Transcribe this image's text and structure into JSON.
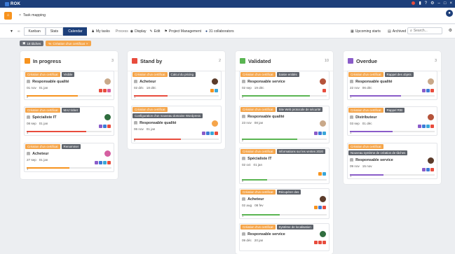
{
  "app": {
    "logo": "ROK"
  },
  "tab": {
    "label": "Task mapping"
  },
  "toolbar": {
    "views": [
      "Kanban",
      "Stats",
      "Calendar"
    ],
    "my_tasks": "My tasks",
    "process_label": "Process",
    "display": "Display",
    "edit": "Edit",
    "project": "Project Management",
    "collaborators": "31 collaborators",
    "upcoming": "Upcoming starts",
    "archived": "Archived",
    "search_placeholder": "Search..."
  },
  "filters": {
    "count_chip": "18 tâches",
    "tag_chip": "Création d'un certificat"
  },
  "columns": [
    {
      "title": "In progress",
      "count": "3",
      "color": "#f7931e",
      "cards": [
        {
          "tags": [
            "Création d'un certificat",
            "Visible"
          ],
          "role": "Responsable qualité",
          "d1": "01 nov",
          "d2": "01 jan",
          "progress": "2"
        },
        {
          "tags": [
            "Création d'un certificat",
            "MAJ ticket"
          ],
          "role": "Spécialiste IT",
          "d1": "08 sep",
          "d2": "01 jan",
          "progress": "3"
        },
        {
          "tags": [
            "Création d'un certificat",
            "Renommer"
          ],
          "role": "Acheteur",
          "d1": "27 sep",
          "d2": "01 jan",
          "progress": "1"
        }
      ]
    },
    {
      "title": "Stand by",
      "count": "2",
      "color": "#e84c3d",
      "cards": [
        {
          "tags": [
            "Création d'un certificat",
            "Calcul du pricing"
          ],
          "role": "Acheteur",
          "d1": "02 déc",
          "d2": "18 déc",
          "progress": "1"
        },
        {
          "tags": [
            "Création d'un certificat",
            "Configuration d'un nouveau domaine Wordpress"
          ],
          "role": "Responsable qualité",
          "d1": "06 nov",
          "d2": "01 jan",
          "progress": "2"
        }
      ]
    },
    {
      "title": "Validated",
      "count": "10",
      "color": "#5ab552",
      "cards": [
        {
          "tags": [
            "Création d'un certificat",
            "Saisie entités"
          ],
          "role": "Responsable service",
          "d1": "02 sep",
          "d2": "19 déc",
          "progress": "2"
        },
        {
          "tags": [
            "Création d'un certificat",
            "Site Web protocole de sécurité"
          ],
          "role": "Responsable qualité",
          "d1": "23 nov",
          "d2": "08 jan",
          "progress": "2"
        },
        {
          "tags": [
            "Création d'un certificat",
            "Informations sur les ventes 2020"
          ],
          "role": "Spécialiste IT",
          "d1": "02 oct",
          "d2": "01 jan",
          "progress": "0"
        },
        {
          "tags": [
            "Création d'un certificat",
            "Récupérer des"
          ],
          "role": "Acheteur",
          "d1": "02 aug",
          "d2": "08 fev",
          "progress": "1"
        },
        {
          "tags": [
            "Création d'un certificat",
            "Système de localisation"
          ],
          "role": "Responsable service",
          "d1": "09 déc",
          "d2": "20 jan",
          "progress": "1"
        }
      ]
    },
    {
      "title": "Overdue",
      "count": "3",
      "color": "#8a5cc9",
      "cards": [
        {
          "tags": [
            "Création d'un certificat",
            "Rappel des objets"
          ],
          "role": "Responsable qualité",
          "d1": "22 nov",
          "d2": "06 déc",
          "progress": "1"
        },
        {
          "tags": [
            "Création d'un certificat",
            "Rappel RIB"
          ],
          "role": "Distributeur",
          "d1": "03 sep",
          "d2": "01 déc",
          "progress": "1"
        },
        {
          "tags": [
            "Création d'un certificat",
            "Nouveau système de création de tâches"
          ],
          "role": "Responsable service",
          "d1": "09 nov",
          "d2": "15 nov",
          "progress": "1"
        }
      ]
    }
  ]
}
